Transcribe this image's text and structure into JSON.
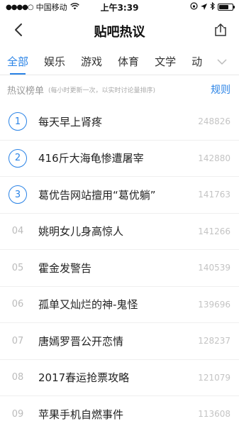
{
  "status_bar": {
    "carrier": "中国移动",
    "time": "上午3:39"
  },
  "nav": {
    "title": "贴吧热议",
    "back_icon": "chevron-left-icon",
    "share_icon": "share-icon"
  },
  "tabs": [
    {
      "label": "全部",
      "active": true
    },
    {
      "label": "娱乐",
      "active": false
    },
    {
      "label": "游戏",
      "active": false
    },
    {
      "label": "体育",
      "active": false
    },
    {
      "label": "文学",
      "active": false
    },
    {
      "label": "动",
      "active": false
    }
  ],
  "list_header": {
    "title": "热议榜单",
    "note": "(每小时更新一次，以实时讨论量排序)",
    "rules_label": "规则"
  },
  "topics": [
    {
      "rank": "1",
      "title": "每天早上肾疼",
      "count": "248826"
    },
    {
      "rank": "2",
      "title": "416斤大海龟惨遭屠宰",
      "count": "142880"
    },
    {
      "rank": "3",
      "title": "葛优告网站擅用“葛优躺”",
      "count": "141763"
    },
    {
      "rank": "04",
      "title": "姚明女儿身高惊人",
      "count": "141266"
    },
    {
      "rank": "05",
      "title": "霍金发警告",
      "count": "140539"
    },
    {
      "rank": "06",
      "title": "孤单又灿烂的神-鬼怪",
      "count": "139696"
    },
    {
      "rank": "07",
      "title": "唐嫣罗晋公开恋情",
      "count": "128237"
    },
    {
      "rank": "08",
      "title": "2017春运抢票攻略",
      "count": "121079"
    },
    {
      "rank": "09",
      "title": "苹果手机自燃事件",
      "count": "113608"
    }
  ],
  "colors": {
    "accent": "#2a83e6"
  }
}
